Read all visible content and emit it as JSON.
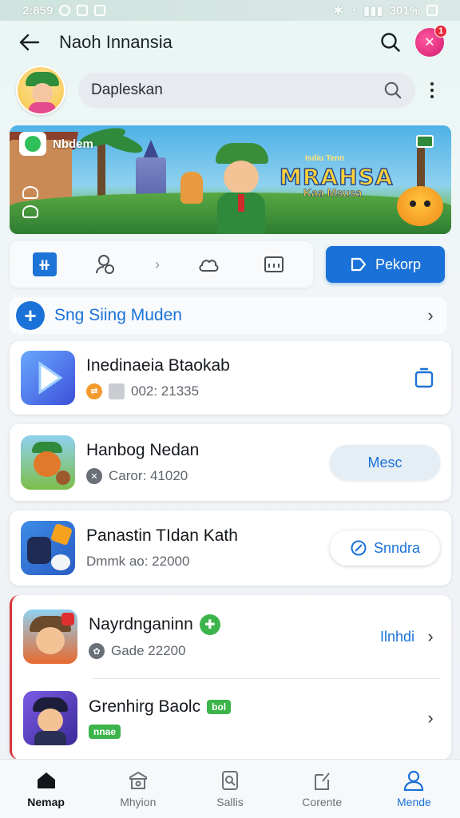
{
  "status_bar": {
    "time": "2:859",
    "battery": "301%"
  },
  "appbar": {
    "title": "Naoh Innansia",
    "notification_count": "1"
  },
  "search": {
    "placeholder": "Dapleskan"
  },
  "banner": {
    "logo_text": "Nbdem",
    "kicker": "Isdiu Tenn",
    "title": "MRAHSA",
    "subtitle": "Kaa Msusa"
  },
  "toolbar": {
    "primary_label": "Pekorp"
  },
  "section": {
    "label": "Sng  Siing Muden"
  },
  "apps": [
    {
      "name": "Inedinaeia Btaokab",
      "meta": "002: 21335",
      "action": "share"
    },
    {
      "name": "Hanbog Nedan",
      "meta": "Caror: 41020",
      "action_label": "Mesc"
    },
    {
      "name": "Panastin TIdan Kath",
      "meta": "Dmmk ao: 22000",
      "action_label": "Snndra"
    },
    {
      "name": "Nayrdnganinn",
      "meta": "Gade 22200",
      "action_label": "Ilnhdi"
    },
    {
      "name": "Grenhirg Baolc",
      "meta_badge": "nnae",
      "title_badge": "bol"
    }
  ],
  "bottom_nav": [
    {
      "label": "Nemap"
    },
    {
      "label": "Mhyion"
    },
    {
      "label": "Sallis"
    },
    {
      "label": "Corente"
    },
    {
      "label": "Mende"
    }
  ],
  "colors": {
    "accent": "#1a72d8",
    "green": "#3cb44b",
    "badge_red": "#e8283b"
  }
}
